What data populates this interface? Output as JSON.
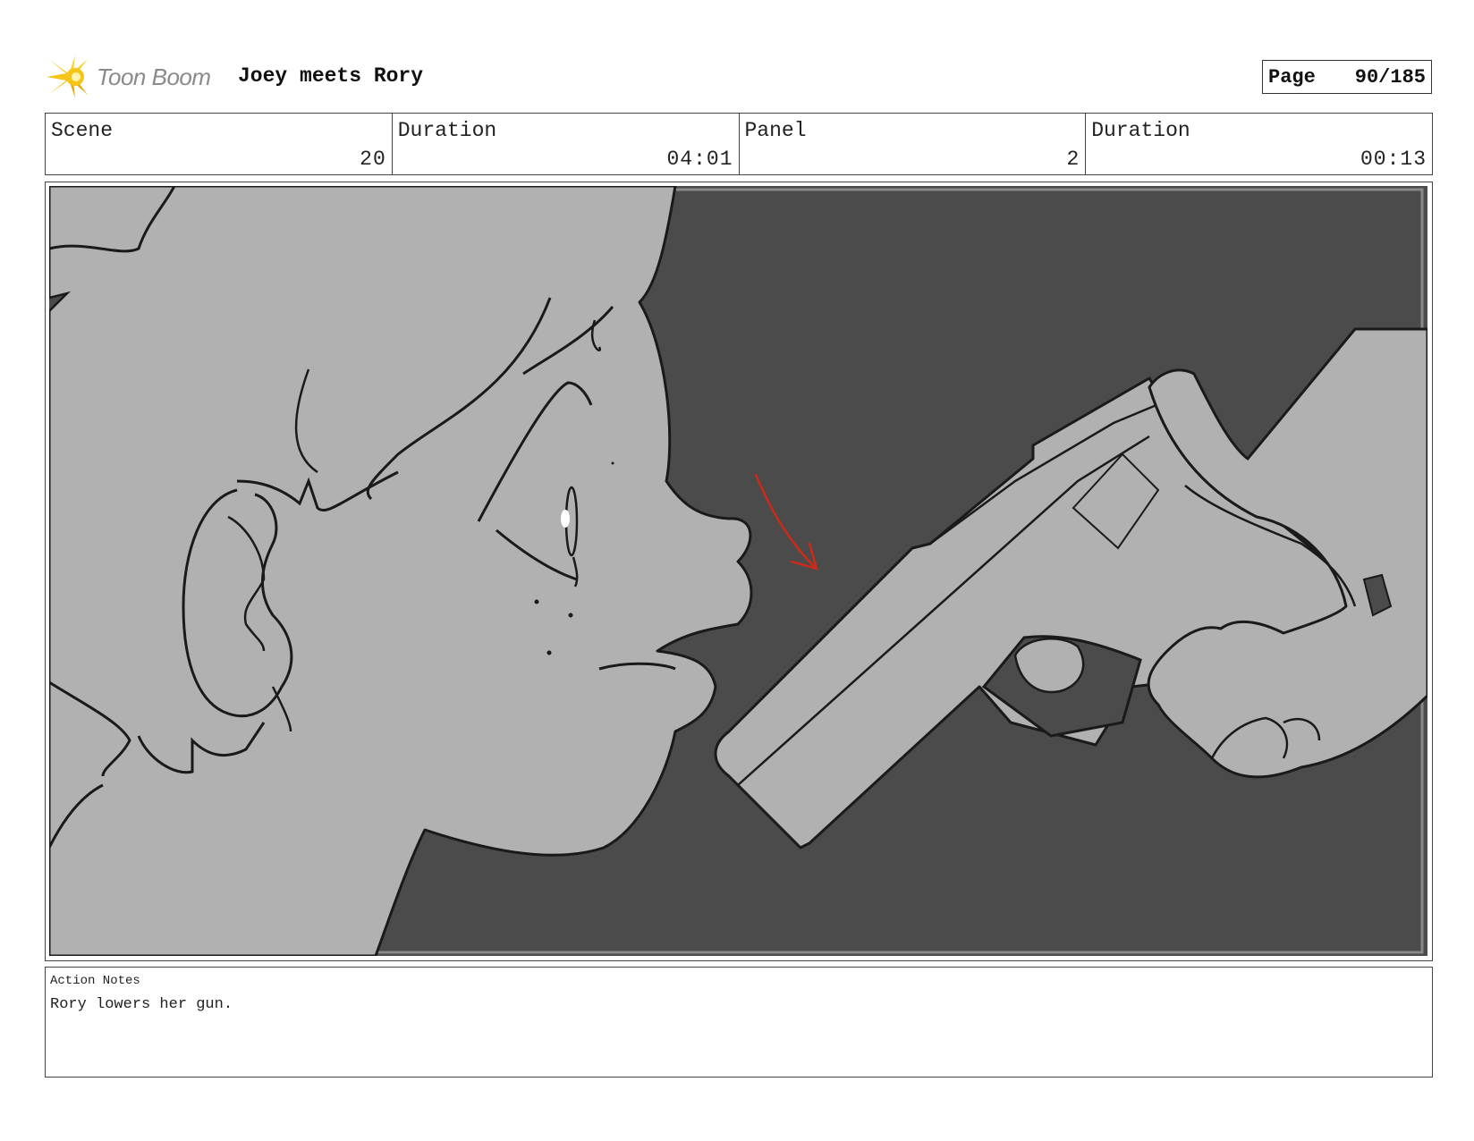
{
  "header": {
    "logo_text": "Toon Boom",
    "project_title": "Joey meets Rory",
    "page_label": "Page",
    "page_number": "90/185"
  },
  "info": {
    "scene_label": "Scene",
    "scene_value": "20",
    "scene_duration_label": "Duration",
    "scene_duration_value": "04:01",
    "panel_label": "Panel",
    "panel_value": "2",
    "panel_duration_label": "Duration",
    "panel_duration_value": "00:13"
  },
  "notes": {
    "label": "Action Notes",
    "text": "Rory lowers her gun."
  },
  "colors": {
    "background_dark": "#4b4b4b",
    "character_fill": "#b1b1b1",
    "line": "#1a1a1a",
    "arrow": "#cc2a1a",
    "logo_yellow": "#f5c518"
  }
}
